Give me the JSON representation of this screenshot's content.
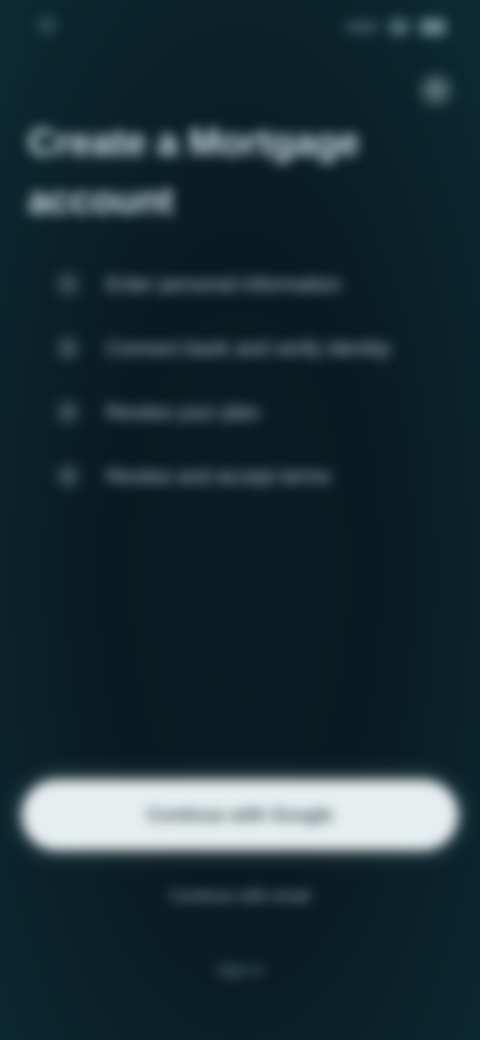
{
  "status_bar": {
    "time": "",
    "icons": [
      "app-icon",
      "signal-icon",
      "wifi-icon",
      "battery-icon"
    ]
  },
  "header": {
    "close_icon": "close-icon",
    "close_glyph": "✕",
    "title": "Create a Mortgage account"
  },
  "steps": [
    {
      "number": "1",
      "text": "Enter personal information"
    },
    {
      "number": "2",
      "text": "Connect bank and verify identity"
    },
    {
      "number": "3",
      "text": "Review your plan"
    },
    {
      "number": "4",
      "text": "Review and accept terms"
    }
  ],
  "actions": {
    "primary_label": "Continue with Google",
    "secondary_label": "Continue with email",
    "tertiary_label": "Sign in"
  },
  "colors": {
    "background": "#0a1a22",
    "primary_button": "#e6eef0",
    "text": "#cfe6ec"
  }
}
